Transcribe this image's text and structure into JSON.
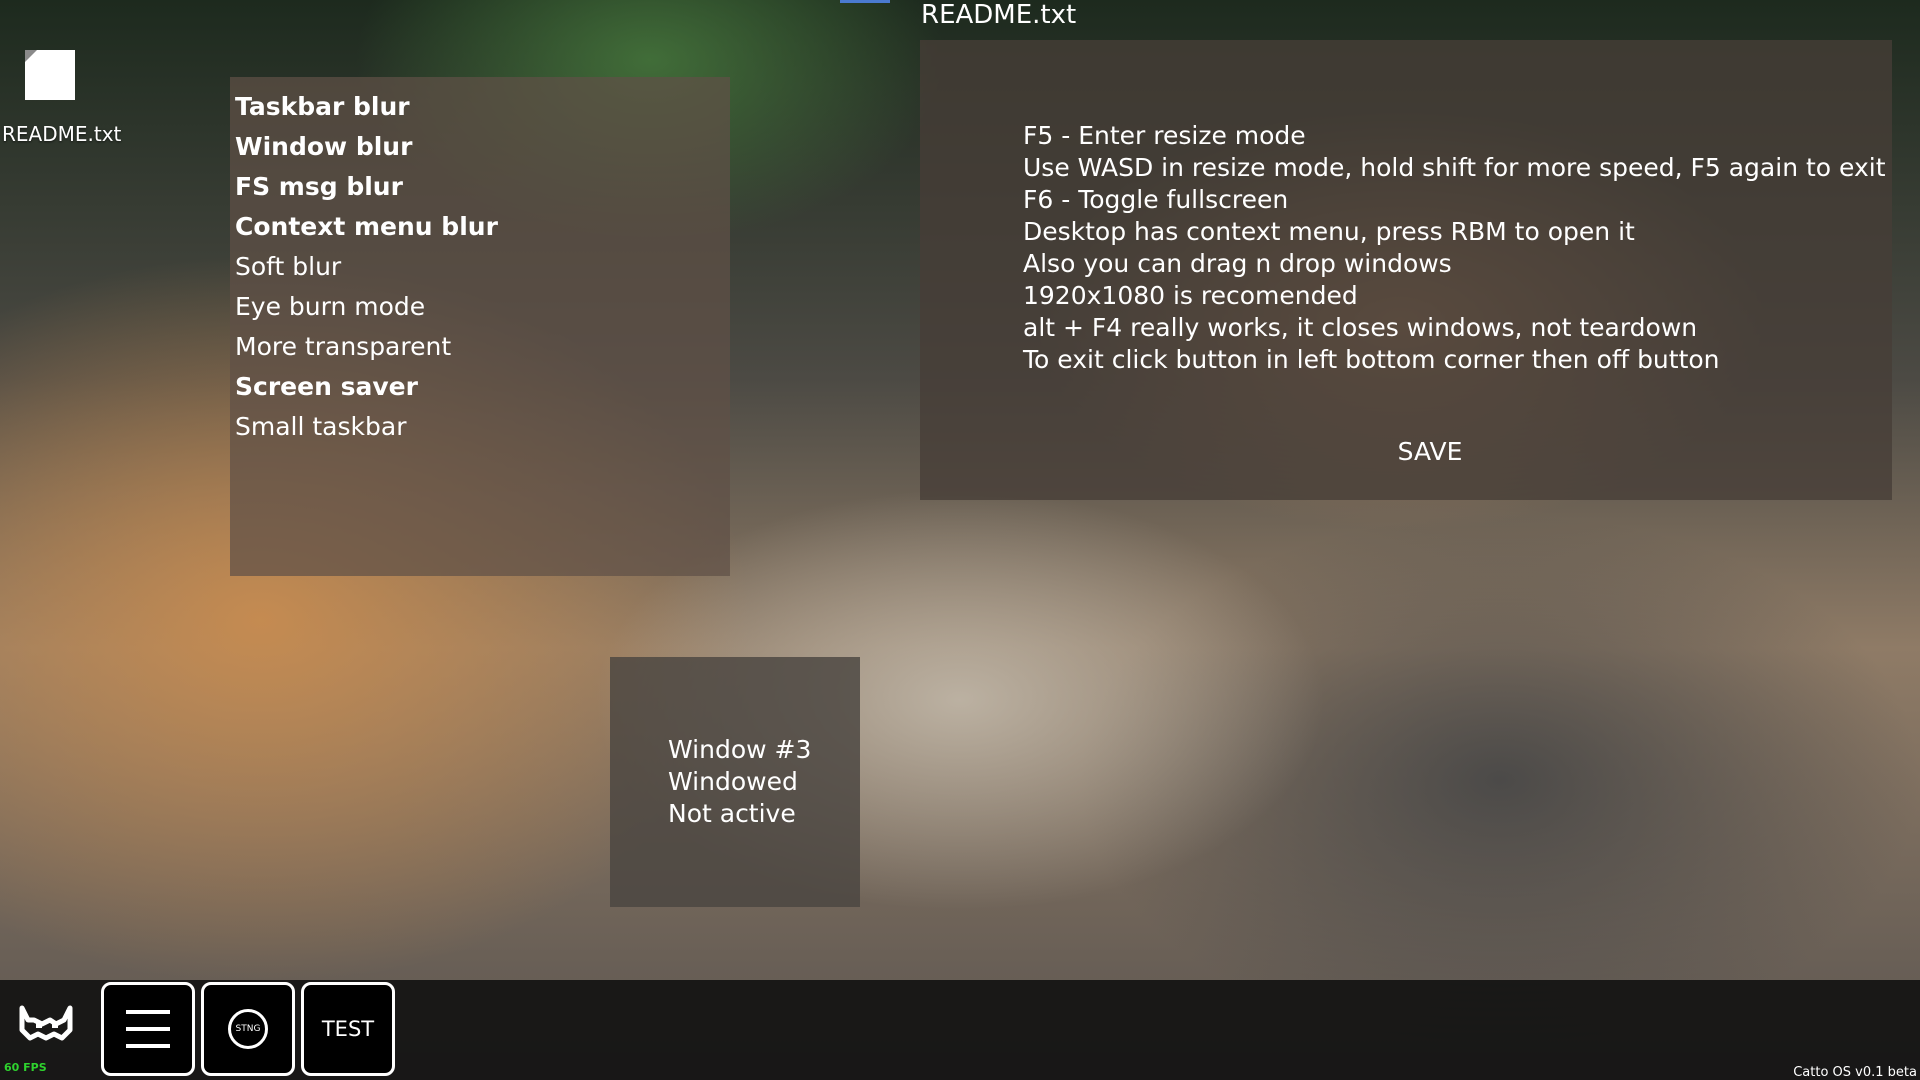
{
  "desktop": {
    "icons": [
      {
        "label": "README.txt",
        "icon": "file-icon"
      }
    ]
  },
  "settings_window": {
    "options": [
      {
        "label": "Taskbar blur",
        "enabled": true
      },
      {
        "label": "Window blur",
        "enabled": true
      },
      {
        "label": "FS msg blur",
        "enabled": true
      },
      {
        "label": "Context menu blur",
        "enabled": true
      },
      {
        "label": "Soft blur",
        "enabled": false
      },
      {
        "label": "Eye burn mode",
        "enabled": false
      },
      {
        "label": "More transparent",
        "enabled": false
      },
      {
        "label": "Screen saver",
        "enabled": true
      },
      {
        "label": "Small taskbar",
        "enabled": false
      }
    ]
  },
  "readme_window": {
    "title": "README.txt",
    "lines": [
      "F5 - Enter resize mode",
      "Use WASD in resize mode, hold shift for more speed, F5 again to exit",
      "F6 - Toggle fullscreen",
      "Desktop has context menu, press RBM to open it",
      "Also you can drag n drop windows",
      "1920x1080 is recomended",
      "alt + F4 really works, it closes windows, not teardown",
      "To exit click button in left bottom corner then off button"
    ],
    "save_label": "SAVE"
  },
  "window3": {
    "lines": [
      "Window #3",
      "Windowed",
      "Not active"
    ]
  },
  "taskbar": {
    "fps": "60 FPS",
    "stng_label": "STNG",
    "test_label": "TEST",
    "version": "Catto OS v0.1 beta",
    "fps_color": "#2ed22e"
  }
}
